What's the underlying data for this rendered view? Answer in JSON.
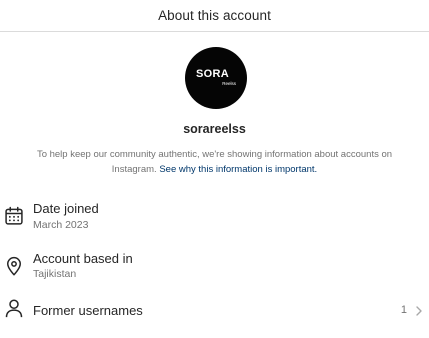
{
  "header": {
    "title": "About this account"
  },
  "profile": {
    "avatar_text": "SORA",
    "avatar_subtext": "Reelss",
    "username": "sorareelss"
  },
  "info": {
    "text": "To help keep our community authentic, we're showing information about accounts on Instagram.",
    "link": "See why this information is important."
  },
  "rows": [
    {
      "icon": "calendar-icon",
      "title": "Date joined",
      "value": "March 2023"
    },
    {
      "icon": "location-pin-icon",
      "title": "Account based in",
      "value": "Tajikistan"
    },
    {
      "icon": "person-icon",
      "title": "Former usernames",
      "count": "1",
      "chevron": "chevron-right-icon"
    }
  ]
}
